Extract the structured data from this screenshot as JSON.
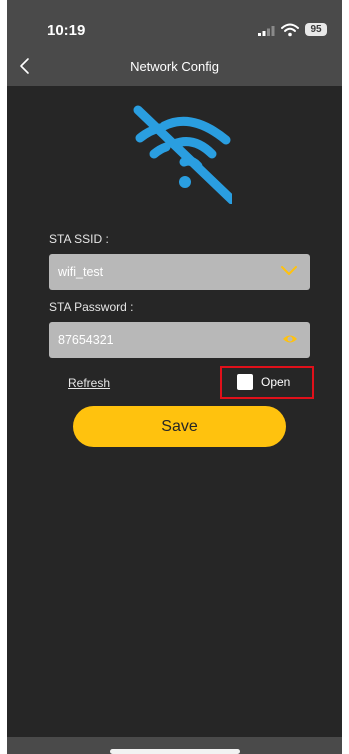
{
  "status_bar": {
    "time": "10:19",
    "battery": "95"
  },
  "header": {
    "title": "Network Config"
  },
  "form": {
    "ssid_label": "STA SSID :",
    "ssid_value": "wifi_test",
    "password_label": "STA Password :",
    "password_value": "87654321",
    "refresh_label": "Refresh",
    "open_label": "Open",
    "open_checked": false,
    "save_label": "Save"
  },
  "icons": {
    "back": "chevron-left-icon",
    "hero": "wifi-off-icon",
    "ssid_dropdown": "chevron-down-icon",
    "password_visibility": "eye-icon"
  },
  "colors": {
    "background": "#262626",
    "header": "#4a4a4a",
    "accent": "#ffc20e",
    "wifi_icon": "#2a9ee0",
    "highlight": "#e0101a"
  }
}
